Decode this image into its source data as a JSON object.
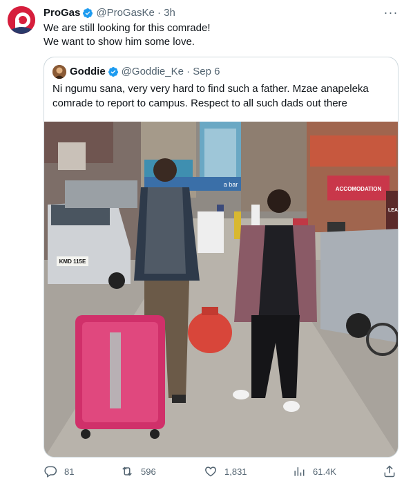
{
  "tweet": {
    "author_name": "ProGas",
    "handle_time": "@ProGasKe · 3h",
    "text_line1": "We are still looking for this comrade!",
    "text_line2": "We want to show him some love."
  },
  "quoted": {
    "author_name": "Goddie",
    "handle_time": "@Goddie_Ke · Sep 6",
    "text": "Ni ngumu sana, very very hard to find such a father. Mzae anapeleka comrade to report to campus. Respect to all such dads out there",
    "photo_signs": [
      "ACCOMODATION",
      "a bar",
      "LEA"
    ],
    "plate": "KMD 115E"
  },
  "actions": {
    "replies": "81",
    "retweets": "596",
    "likes": "1,831",
    "views": "61.4K"
  },
  "colors": {
    "accent": "#1d9bf0",
    "brand": "#d61e3c",
    "muted": "#536471"
  }
}
